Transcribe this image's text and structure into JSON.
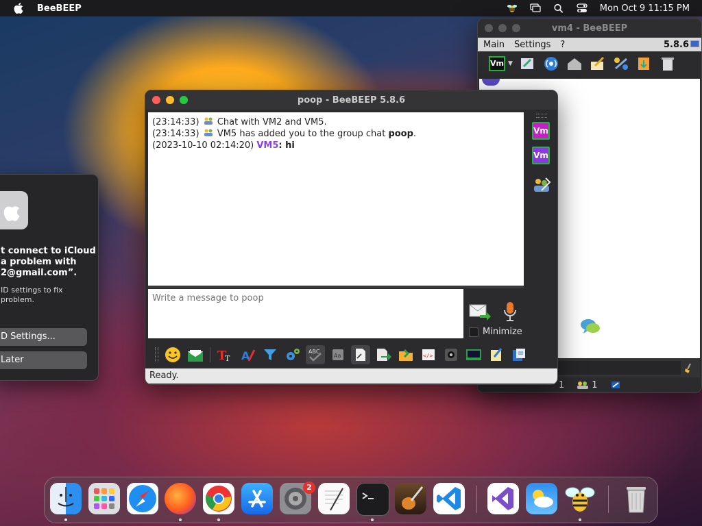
{
  "menubar": {
    "app_name": "BeeBEEP",
    "clock": "Mon Oct 9  11:15 PM"
  },
  "icloud_dialog": {
    "message": "t connect to iCloud\na problem with\n2@gmail.com”.",
    "message_line1": "t connect to iCloud",
    "message_line2": "a problem with",
    "message_line3": "2@gmail.com”.",
    "sub_line1": "ID settings to fix",
    "sub_line2": "problem.",
    "settings_button": "D Settings...",
    "later_button": "Later"
  },
  "vm4_window": {
    "title": "vm4 - BeeBEEP",
    "menu": [
      "Main",
      "Settings",
      "?"
    ],
    "version": "5.8.6",
    "status_counts": [
      "1",
      "1"
    ]
  },
  "chat_window": {
    "title": "poop - BeeBEEP 5.8.6",
    "messages": [
      {
        "time": "(23:14:33)",
        "text": "Chat with VM2 and VM5."
      },
      {
        "time": "(23:14:33)",
        "text_before": "VM5 has added you to the group chat ",
        "bold": "poop",
        "text_after": "."
      },
      {
        "time": "(2023-10-10 02:14:20)",
        "user": "VM5",
        "text": ": hi"
      }
    ],
    "input_placeholder": "Write a message to poop",
    "minimize_label": "Minimize",
    "sidebar_badges": [
      "Vm",
      "Vm"
    ],
    "status": "Ready."
  },
  "vm_badge_label": "Vm",
  "dock": {
    "settings_badge": "2",
    "apps": [
      "finder",
      "launchpad",
      "safari",
      "firefox",
      "chrome",
      "app-store",
      "system-settings",
      "textedit",
      "terminal",
      "garageband",
      "vscode",
      "visual-studio",
      "weather",
      "beebeep",
      "trash"
    ]
  },
  "colors": {
    "chat_user": "#8b3fe6",
    "vm_badge_border": "#25b13d",
    "vm_badge_fill": "#c51fc5"
  }
}
